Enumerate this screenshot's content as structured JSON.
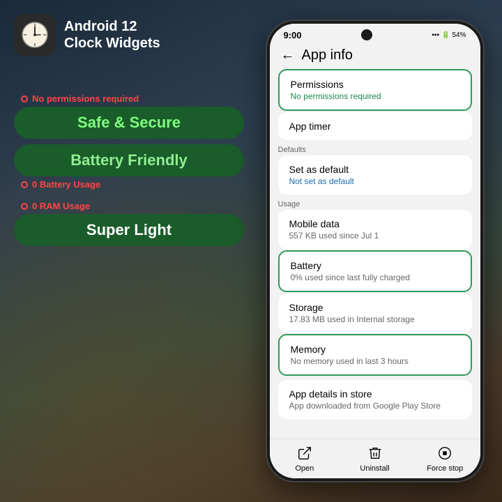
{
  "app": {
    "icon_label": "Clock icon",
    "title_line1": "Android 12",
    "title_line2": "Clock Widgets"
  },
  "badges": {
    "no_permissions_annotation": "No permissions required",
    "safe_secure_label": "Safe & Secure",
    "battery_friendly_label": "Battery Friendly",
    "battery_usage_annotation": "0 Battery Usage",
    "ram_usage_annotation": "0 RAM Usage",
    "super_light_label": "Super Light"
  },
  "phone": {
    "status_time": "9:00",
    "status_battery": "54%",
    "app_bar_title": "App info",
    "sections": [
      {
        "title": "Permissions",
        "subtitle": "No permissions required",
        "highlighted": true
      },
      {
        "title": "App timer",
        "subtitle": "",
        "highlighted": false
      },
      {
        "label": "Defaults"
      },
      {
        "title": "Set as default",
        "subtitle": "Not set as default",
        "highlighted": false
      },
      {
        "label": "Usage"
      },
      {
        "title": "Mobile data",
        "subtitle": "557 KB used since Jul 1",
        "highlighted": false
      },
      {
        "title": "Battery",
        "subtitle": "0% used since last fully charged",
        "highlighted": true
      },
      {
        "title": "Storage",
        "subtitle": "17.83 MB used in internal storage",
        "highlighted": false
      },
      {
        "title": "Memory",
        "subtitle": "No memory used in last 3 hours",
        "highlighted": true
      },
      {
        "title": "App details in store",
        "subtitle": "App downloaded from Google Play Store",
        "highlighted": false
      }
    ],
    "bottom_nav": [
      {
        "label": "Open",
        "icon": "open-icon"
      },
      {
        "label": "Uninstall",
        "icon": "uninstall-icon"
      },
      {
        "label": "Force stop",
        "icon": "force-stop-icon"
      }
    ]
  }
}
